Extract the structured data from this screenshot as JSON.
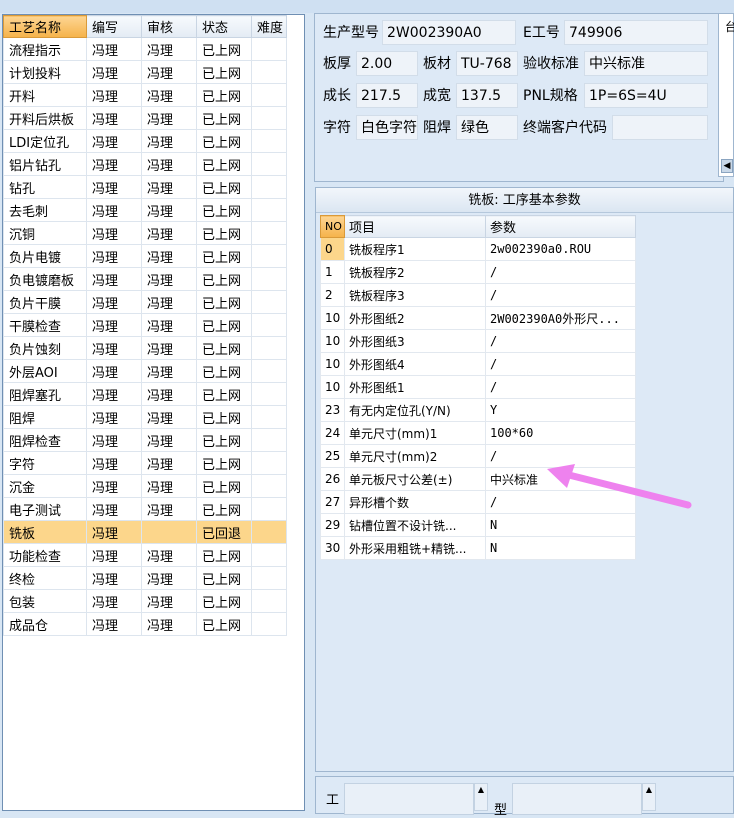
{
  "process_list": {
    "headers": [
      "工艺名称",
      "编写",
      "审核",
      "状态",
      "难度"
    ],
    "rows": [
      [
        "流程指示",
        "冯理",
        "冯理",
        "已上网",
        ""
      ],
      [
        "计划投料",
        "冯理",
        "冯理",
        "已上网",
        ""
      ],
      [
        "开料",
        "冯理",
        "冯理",
        "已上网",
        ""
      ],
      [
        "开料后烘板",
        "冯理",
        "冯理",
        "已上网",
        ""
      ],
      [
        "LDI定位孔",
        "冯理",
        "冯理",
        "已上网",
        ""
      ],
      [
        "铝片钻孔",
        "冯理",
        "冯理",
        "已上网",
        ""
      ],
      [
        "钻孔",
        "冯理",
        "冯理",
        "已上网",
        ""
      ],
      [
        "去毛刺",
        "冯理",
        "冯理",
        "已上网",
        ""
      ],
      [
        "沉铜",
        "冯理",
        "冯理",
        "已上网",
        ""
      ],
      [
        "负片电镀",
        "冯理",
        "冯理",
        "已上网",
        ""
      ],
      [
        "负电镀磨板",
        "冯理",
        "冯理",
        "已上网",
        ""
      ],
      [
        "负片干膜",
        "冯理",
        "冯理",
        "已上网",
        ""
      ],
      [
        "干膜检查",
        "冯理",
        "冯理",
        "已上网",
        ""
      ],
      [
        "负片蚀刻",
        "冯理",
        "冯理",
        "已上网",
        ""
      ],
      [
        "外层AOI",
        "冯理",
        "冯理",
        "已上网",
        ""
      ],
      [
        "阻焊塞孔",
        "冯理",
        "冯理",
        "已上网",
        ""
      ],
      [
        "阻焊",
        "冯理",
        "冯理",
        "已上网",
        ""
      ],
      [
        "阻焊检查",
        "冯理",
        "冯理",
        "已上网",
        ""
      ],
      [
        "字符",
        "冯理",
        "冯理",
        "已上网",
        ""
      ],
      [
        "沉金",
        "冯理",
        "冯理",
        "已上网",
        ""
      ],
      [
        "电子测试",
        "冯理",
        "冯理",
        "已上网",
        ""
      ],
      [
        "铣板",
        "冯理",
        "",
        "已回退",
        ""
      ],
      [
        "功能检查",
        "冯理",
        "冯理",
        "已上网",
        ""
      ],
      [
        "终检",
        "冯理",
        "冯理",
        "已上网",
        ""
      ],
      [
        "包装",
        "冯理",
        "冯理",
        "已上网",
        ""
      ],
      [
        "成品仓",
        "冯理",
        "冯理",
        "已上网",
        ""
      ]
    ],
    "selected_row": "铣板"
  },
  "info": {
    "product_model_label": "生产型号",
    "product_model": "2W002390A0",
    "e_no_label": "E工号",
    "e_no": "749906",
    "thickness_label": "板厚",
    "thickness": "2.00",
    "material_label": "板材",
    "material": "TU-768",
    "acceptance_label": "验收标准",
    "acceptance": "中兴标准",
    "length_label": "成长",
    "length": "217.5",
    "width_label": "成宽",
    "width": "137.5",
    "pnl_label": "PNL规格",
    "pnl": "1P=6S=4U",
    "char_label": "字符",
    "char_value": "白色字符",
    "mask_label": "阻焊",
    "mask_value": "绿色",
    "customer_label": "终端客户代码",
    "customer": "",
    "right_stub_char": "台"
  },
  "params": {
    "title": "铣板: 工序基本参数",
    "headers": [
      "NO",
      "项目",
      "参数"
    ],
    "rows": [
      [
        "0",
        "铣板程序1",
        "2w002390a0.ROU"
      ],
      [
        "1",
        "铣板程序2",
        "/"
      ],
      [
        "2",
        "铣板程序3",
        "/"
      ],
      [
        "10",
        "外形图纸2",
        "2W002390A0外形尺..."
      ],
      [
        "10",
        "外形图纸3",
        "/"
      ],
      [
        "10",
        "外形图纸4",
        "/"
      ],
      [
        "10",
        "外形图纸1",
        "/"
      ],
      [
        "23",
        "有无内定位孔(Y/N)",
        "Y"
      ],
      [
        "24",
        "单元尺寸(mm)1",
        "100*60"
      ],
      [
        "25",
        "单元尺寸(mm)2",
        "/"
      ],
      [
        "26",
        "单元板尺寸公差(±)",
        "中兴标准"
      ],
      [
        "27",
        "异形槽个数",
        "/"
      ],
      [
        "29",
        "钻槽位置不设计铣...",
        "N"
      ],
      [
        "30",
        "外形采用粗铣+精铣...",
        "N"
      ]
    ]
  },
  "annotation": {
    "color": "#ee82ee"
  },
  "bottom": {
    "label1": "工",
    "label2": "型"
  }
}
